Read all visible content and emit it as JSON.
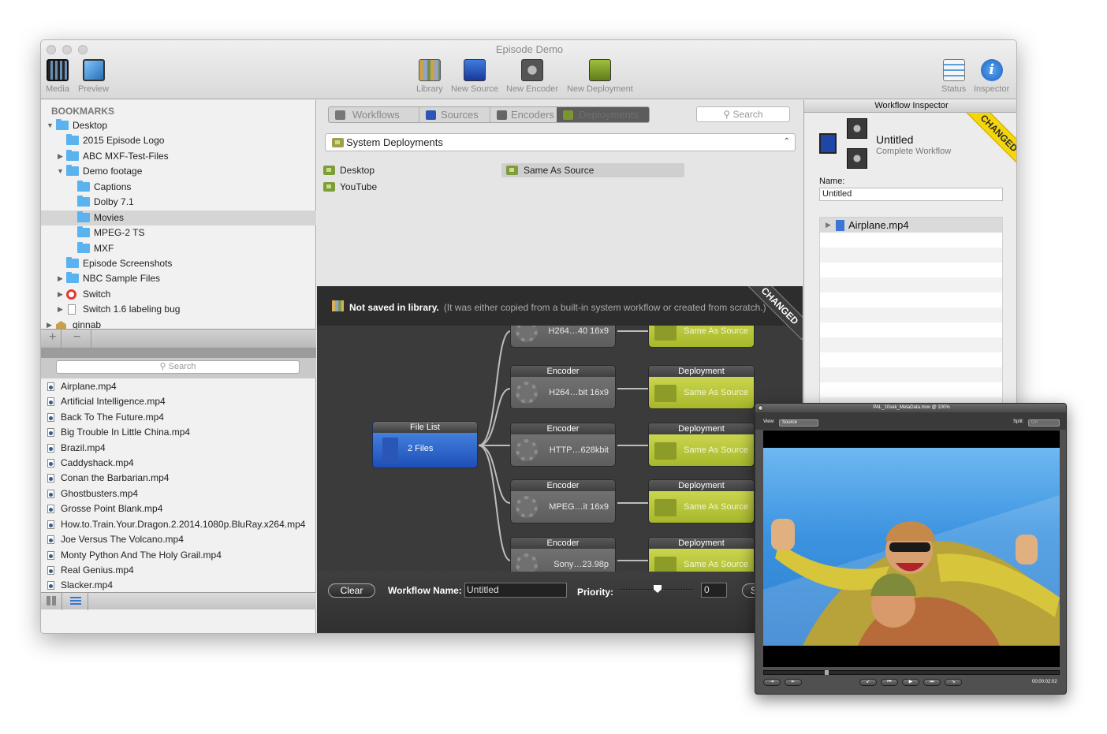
{
  "window": {
    "title": "Episode Demo"
  },
  "toolbar": {
    "left": [
      {
        "label": "Media",
        "icon": "film-strip-icon"
      },
      {
        "label": "Preview",
        "icon": "preview-icon"
      }
    ],
    "center": [
      {
        "label": "Library",
        "icon": "library-books-icon"
      },
      {
        "label": "New Source",
        "icon": "new-source-icon"
      },
      {
        "label": "New Encoder",
        "icon": "new-encoder-icon"
      },
      {
        "label": "New Deployment",
        "icon": "new-deployment-icon"
      }
    ],
    "right": [
      {
        "label": "Status",
        "icon": "status-icon"
      },
      {
        "label": "Inspector",
        "icon": "info-icon"
      }
    ]
  },
  "sidebar": {
    "bookmarks_header": "BOOKMARKS",
    "tree": [
      {
        "label": "Desktop",
        "expanded": true
      },
      {
        "label": "2015 Episode Logo"
      },
      {
        "label": "ABC MXF-Test-Files",
        "collapsed": true
      },
      {
        "label": "Demo footage",
        "expanded": true
      },
      {
        "label": "Captions"
      },
      {
        "label": "Dolby 7.1"
      },
      {
        "label": "Movies",
        "selected": true
      },
      {
        "label": "MPEG-2 TS"
      },
      {
        "label": "MXF"
      },
      {
        "label": "Episode Screenshots"
      },
      {
        "label": "NBC Sample Files",
        "collapsed": true
      },
      {
        "label": "Switch",
        "collapsed": true
      },
      {
        "label": "Switch 1.6 labeling bug",
        "collapsed": true
      },
      {
        "label": "ginnab",
        "collapsed": true
      }
    ],
    "add_label": "+",
    "remove_label": "−",
    "file_search_placeholder": "Search",
    "files": [
      "Airplane.mp4",
      "Artificial Intelligence.mp4",
      "Back To The Future.mp4",
      "Big Trouble In Little China.mp4",
      "Brazil.mp4",
      "Caddyshack.mp4",
      "Conan the Barbarian.mp4",
      "Ghostbusters.mp4",
      "Grosse Point Blank.mp4",
      "How.to.Train.Your.Dragon.2.2014.1080p.BluRay.x264.mp4",
      "Joe Versus The Volcano.mp4",
      "Monty Python And The Holy Grail.mp4",
      "Real Genius.mp4",
      "Slacker.mp4"
    ]
  },
  "library": {
    "tabs": [
      "Workflows",
      "Sources",
      "Encoders",
      "Deployments"
    ],
    "active_tab": "Deployments",
    "search_placeholder": "Search",
    "selector_value": "System Deployments",
    "items_left": [
      "Desktop",
      "YouTube"
    ],
    "items_right": [
      "Same As Source"
    ]
  },
  "workflow": {
    "notice_title": "Not saved in library.",
    "notice_detail": "(It was either copied from a built-in system workflow or created from scratch.)",
    "changed_label": "CHANGED",
    "file_list": {
      "title": "File List",
      "label": "2 Files"
    },
    "encoder_title": "Encoder",
    "deployment_title": "Deployment",
    "encoders": [
      "H264…40 16x9",
      "H264…bit 16x9",
      "HTTP…628kbit",
      "MPEG…it 16x9",
      "Sony…23.98p"
    ],
    "deployments": [
      "Same As Source",
      "Same As Source",
      "Same As Source",
      "Same As Source",
      "Same As Source"
    ],
    "clear_label": "Clear",
    "name_label": "Workflow Name:",
    "name_value": "Untitled",
    "priority_label": "Priority:",
    "priority_value": "0",
    "submit_label": "S"
  },
  "inspector": {
    "header": "Workflow Inspector",
    "changed_label": "CHANGED",
    "title": "Untitled",
    "subtitle": "Complete Workflow",
    "name_label": "Name:",
    "name_value": "Untitled",
    "list_item": "Airplane.mp4"
  },
  "viewer": {
    "title": "PAL_10sek_MetaData.mov @ 100%",
    "view_label": "View:",
    "view_value": "Source",
    "split_label": "Split:",
    "split_value": "On",
    "timecode": "00:00:02:02"
  },
  "colors": {
    "file_list_blue": "#2a62cf",
    "deployment_green": "#c2cd3f",
    "changed_yellow": "#f4d60b",
    "folder_blue": "#5ab2ee"
  }
}
